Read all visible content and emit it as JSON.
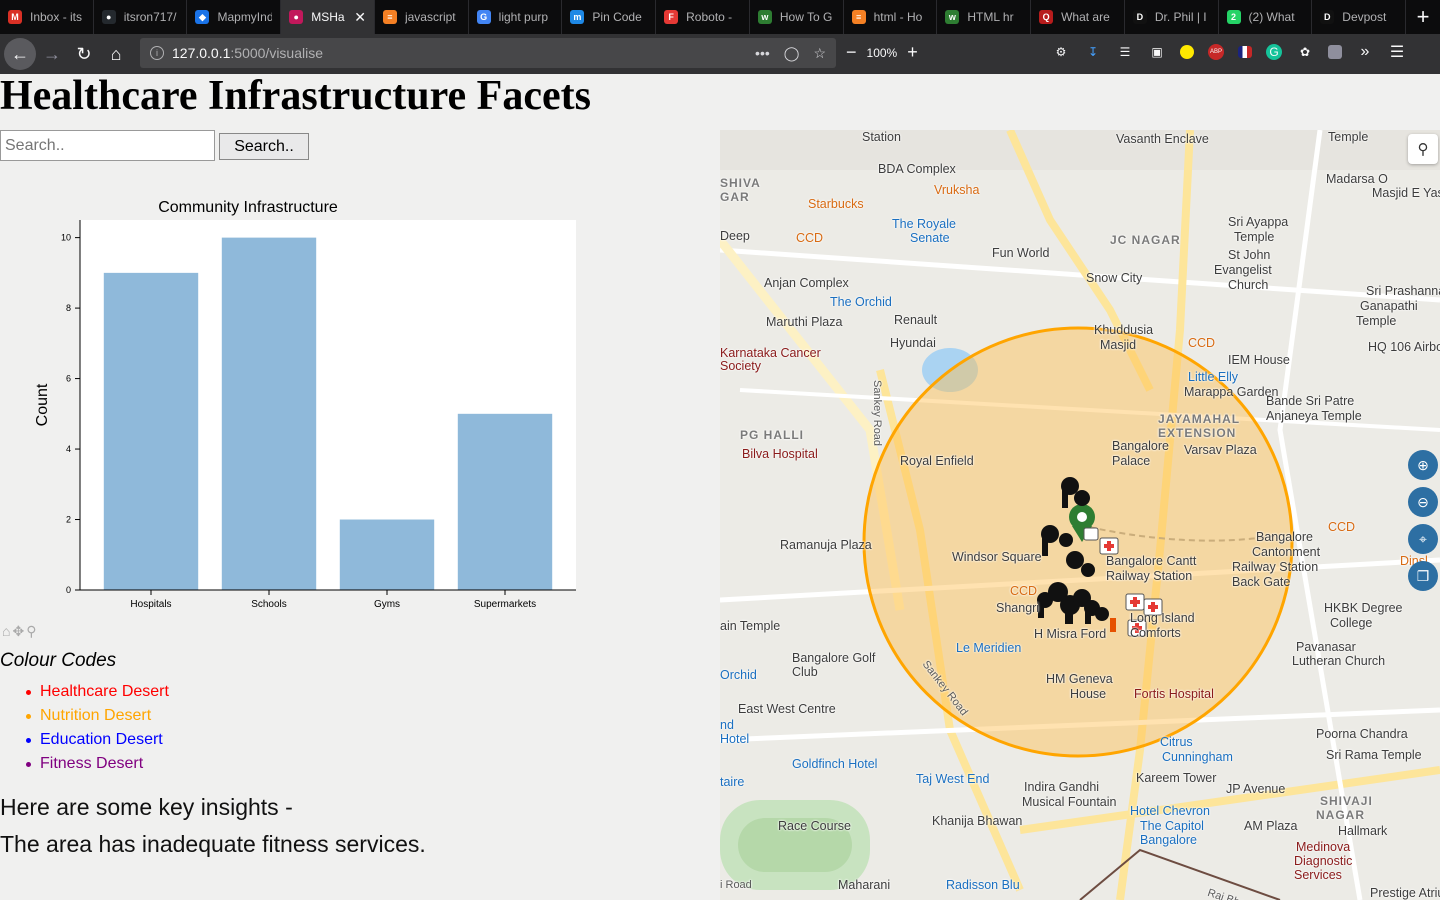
{
  "browser": {
    "tabs": [
      {
        "title": "Inbox - its",
        "color": "#d93025",
        "glyph": "M"
      },
      {
        "title": "itsron717/",
        "color": "#24292e",
        "glyph": "●"
      },
      {
        "title": "MapmyInd",
        "color": "#1a73e8",
        "glyph": "◆"
      },
      {
        "title": "MSHa",
        "color": "#c2185b",
        "glyph": "●",
        "active": true
      },
      {
        "title": "javascript",
        "color": "#f48024",
        "glyph": "≡"
      },
      {
        "title": "light purp",
        "color": "#4285f4",
        "glyph": "G"
      },
      {
        "title": "Pin Code",
        "color": "#1e88e5",
        "glyph": "m"
      },
      {
        "title": "Roboto -",
        "color": "#e53935",
        "glyph": "F"
      },
      {
        "title": "How To G",
        "color": "#2e7d32",
        "glyph": "w"
      },
      {
        "title": "html - Ho",
        "color": "#f48024",
        "glyph": "≡"
      },
      {
        "title": "HTML hr",
        "color": "#2e7d32",
        "glyph": "w"
      },
      {
        "title": "What are",
        "color": "#b71c1c",
        "glyph": "Q"
      },
      {
        "title": "Dr. Phil | I",
        "color": "#111",
        "glyph": "D"
      },
      {
        "title": "(2) What",
        "color": "#25d366",
        "glyph": "2"
      },
      {
        "title": "Devpost",
        "color": "#111",
        "glyph": "D"
      }
    ],
    "new_tab": "+",
    "url_host": "127.0.0.1",
    "url_path": ":5000/visualise",
    "zoom": "100%"
  },
  "page": {
    "title": "Healthcare Infrastructure Facets",
    "search_placeholder": "Search..",
    "search_button": "Search..",
    "legend_title": "Colour Codes",
    "legend": [
      {
        "label": "Healthcare Desert",
        "color": "#ff0000"
      },
      {
        "label": "Nutrition Desert",
        "color": "#ffa500"
      },
      {
        "label": "Education Desert",
        "color": "#0000ff"
      },
      {
        "label": "Fitness Desert",
        "color": "#800080"
      }
    ],
    "insights_title": "Here are some key insights -",
    "insight": "The area has inadequate fitness services."
  },
  "chart_data": {
    "type": "bar",
    "title": "Community Infrastructure",
    "xlabel": "",
    "ylabel": "Count",
    "categories": [
      "Hospitals",
      "Schools",
      "Gyms",
      "Supermarkets"
    ],
    "values": [
      9,
      10,
      2,
      5
    ],
    "ylim": [
      0,
      10.5
    ],
    "yticks": [
      0,
      2,
      4,
      6,
      8,
      10
    ],
    "bar_color": "#8fb9da",
    "grid": false
  },
  "map": {
    "circle_color": "#ffa500",
    "labels": [
      {
        "text": "Station",
        "cls": ""
      },
      {
        "text": "Vasanth Enclave",
        "cls": ""
      },
      {
        "text": "Temple",
        "cls": ""
      },
      {
        "text": "BDA Complex",
        "cls": ""
      },
      {
        "text": "Vruksha",
        "cls": "poi-orange"
      },
      {
        "text": "Madarsa O",
        "cls": ""
      },
      {
        "text": "Masjid E Yaseen",
        "cls": ""
      },
      {
        "text": "SHIVA",
        "cls": "area"
      },
      {
        "text": "GAR",
        "cls": "area"
      },
      {
        "text": "Starbucks",
        "cls": "poi-orange"
      },
      {
        "text": "The Royale",
        "cls": "poi-blue"
      },
      {
        "text": "Senate",
        "cls": "poi-blue"
      },
      {
        "text": "Sri Ayappa",
        "cls": ""
      },
      {
        "text": "Temple",
        "cls": ""
      },
      {
        "text": "Deep",
        "cls": ""
      },
      {
        "text": "CCD",
        "cls": "poi-orange"
      },
      {
        "text": "JC NAGAR",
        "cls": "area"
      },
      {
        "text": "Fun World",
        "cls": ""
      },
      {
        "text": "St John",
        "cls": ""
      },
      {
        "text": "Evangelist",
        "cls": ""
      },
      {
        "text": "Church",
        "cls": ""
      },
      {
        "text": "Snow City",
        "cls": ""
      },
      {
        "text": "Anjan Complex",
        "cls": ""
      },
      {
        "text": "Sri Prashanna",
        "cls": ""
      },
      {
        "text": "Ganapathi",
        "cls": ""
      },
      {
        "text": "Temple",
        "cls": ""
      },
      {
        "text": "The Orchid",
        "cls": "poi-blue"
      },
      {
        "text": "Maruthi Plaza",
        "cls": ""
      },
      {
        "text": "Renault",
        "cls": ""
      },
      {
        "text": "Khuddusia",
        "cls": ""
      },
      {
        "text": "Masjid",
        "cls": ""
      },
      {
        "text": "CCD",
        "cls": "poi-orange"
      },
      {
        "text": "HQ 106 Airbo",
        "cls": ""
      },
      {
        "text": "Hyundai",
        "cls": ""
      },
      {
        "text": "IEM House",
        "cls": ""
      },
      {
        "text": "Karnataka Cancer",
        "cls": "poi-red"
      },
      {
        "text": "Society",
        "cls": "poi-red"
      },
      {
        "text": "Little Elly",
        "cls": "poi-blue"
      },
      {
        "text": "Marappa Garden",
        "cls": ""
      },
      {
        "text": "Bande Sri Patre",
        "cls": ""
      },
      {
        "text": "Anjaneya Temple",
        "cls": ""
      },
      {
        "text": "JAYAMAHAL",
        "cls": "area"
      },
      {
        "text": "EXTENSION",
        "cls": "area"
      },
      {
        "text": "PG HALLI",
        "cls": "area"
      },
      {
        "text": "Varsav Plaza",
        "cls": ""
      },
      {
        "text": "Bangalore",
        "cls": ""
      },
      {
        "text": "Palace",
        "cls": ""
      },
      {
        "text": "Bilva Hospital",
        "cls": "poi-red"
      },
      {
        "text": "Royal Enfield",
        "cls": ""
      },
      {
        "text": "Sankey Road",
        "cls": "road"
      },
      {
        "text": "CCD",
        "cls": "poi-orange"
      },
      {
        "text": "Ramanuja Plaza",
        "cls": ""
      },
      {
        "text": "Windsor Square",
        "cls": ""
      },
      {
        "text": "Bangalore Cantt",
        "cls": ""
      },
      {
        "text": "Railway Station",
        "cls": ""
      },
      {
        "text": "Bangalore",
        "cls": ""
      },
      {
        "text": "Cantonment",
        "cls": ""
      },
      {
        "text": "Railway Station",
        "cls": ""
      },
      {
        "text": "Back Gate",
        "cls": ""
      },
      {
        "text": "Dinsl",
        "cls": "poi-orange"
      },
      {
        "text": "CCD",
        "cls": "poi-orange"
      },
      {
        "text": "Shangri",
        "cls": ""
      },
      {
        "text": "Long Island",
        "cls": ""
      },
      {
        "text": "Comforts",
        "cls": ""
      },
      {
        "text": "HKBK Degree",
        "cls": ""
      },
      {
        "text": "College",
        "cls": ""
      },
      {
        "text": "ain Temple",
        "cls": ""
      },
      {
        "text": "H Misra Ford",
        "cls": ""
      },
      {
        "text": "Pavanasar",
        "cls": ""
      },
      {
        "text": "Lutheran Church",
        "cls": ""
      },
      {
        "text": "Bangalore Golf",
        "cls": ""
      },
      {
        "text": "Club",
        "cls": ""
      },
      {
        "text": "Le Meridien",
        "cls": "poi-blue"
      },
      {
        "text": "Orchid",
        "cls": "poi-blue"
      },
      {
        "text": "Sankey Road",
        "cls": "road"
      },
      {
        "text": "HM Geneva",
        "cls": ""
      },
      {
        "text": "House",
        "cls": ""
      },
      {
        "text": "Fortis Hospital",
        "cls": "poi-red"
      },
      {
        "text": "East West Centre",
        "cls": ""
      },
      {
        "text": "nd",
        "cls": "poi-blue"
      },
      {
        "text": "Hotel",
        "cls": "poi-blue"
      },
      {
        "text": "Poorna Chandra",
        "cls": ""
      },
      {
        "text": "Citrus",
        "cls": "poi-blue"
      },
      {
        "text": "Cunningham",
        "cls": "poi-blue"
      },
      {
        "text": "Goldfinch Hotel",
        "cls": "poi-blue"
      },
      {
        "text": "Sri Rama Temple",
        "cls": ""
      },
      {
        "text": "Kareem Tower",
        "cls": ""
      },
      {
        "text": "taire",
        "cls": "poi-blue"
      },
      {
        "text": "Taj West End",
        "cls": "poi-blue"
      },
      {
        "text": "Indira Gandhi",
        "cls": ""
      },
      {
        "text": "Musical Fountain",
        "cls": ""
      },
      {
        "text": "JP Avenue",
        "cls": ""
      },
      {
        "text": "SHIVAJI",
        "cls": "area"
      },
      {
        "text": "NAGAR",
        "cls": "area"
      },
      {
        "text": "Hotel Chevron",
        "cls": "poi-blue"
      },
      {
        "text": "Race Course",
        "cls": ""
      },
      {
        "text": "Khanija Bhawan",
        "cls": ""
      },
      {
        "text": "The Capitol",
        "cls": "poi-blue"
      },
      {
        "text": "Bangalore",
        "cls": "poi-blue"
      },
      {
        "text": "AM Plaza",
        "cls": ""
      },
      {
        "text": "Hallmark",
        "cls": ""
      },
      {
        "text": "Medinova",
        "cls": "poi-red"
      },
      {
        "text": "Diagnostic",
        "cls": "poi-red"
      },
      {
        "text": "Services",
        "cls": "poi-red"
      },
      {
        "text": "i Road",
        "cls": "road"
      },
      {
        "text": "Maharani",
        "cls": ""
      },
      {
        "text": "Radisson Blu",
        "cls": "poi-blue"
      },
      {
        "text": "Raj Bhavan",
        "cls": "road"
      },
      {
        "text": "Prestige Atrium",
        "cls": ""
      }
    ]
  }
}
